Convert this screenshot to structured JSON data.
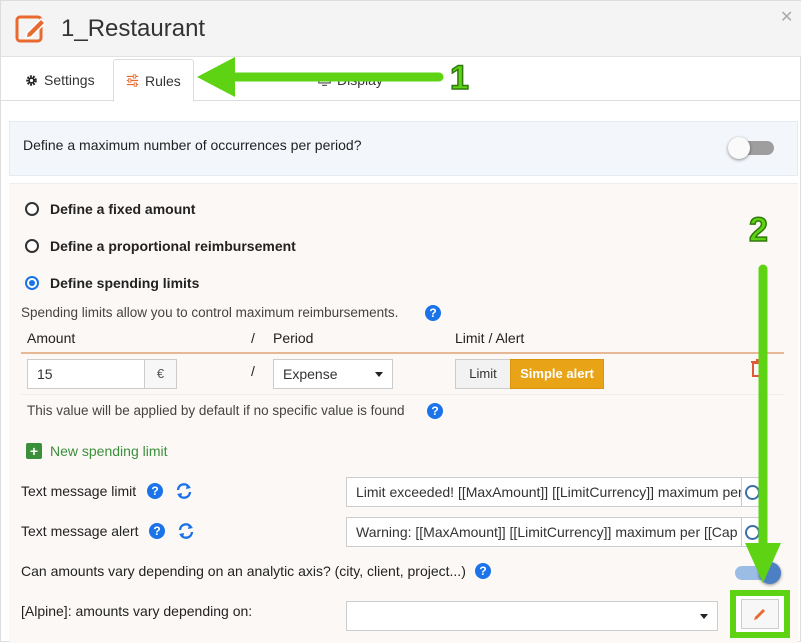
{
  "window": {
    "title": "1_Restaurant"
  },
  "tabs": [
    {
      "label": "Settings",
      "icon": "gear-icon"
    },
    {
      "label": "Rules",
      "icon": "sliders-icon",
      "active": true
    },
    {
      "label": "Display",
      "icon": "display-icon"
    }
  ],
  "annotations": {
    "marker1": "1",
    "marker2": "2",
    "arrow_color": "#5ed313"
  },
  "max_occurrences": {
    "question": "Define a maximum number of occurrences per period?",
    "enabled": false
  },
  "options": [
    {
      "label": "Define a fixed amount",
      "selected": false
    },
    {
      "label": "Define a proportional reimbursement",
      "selected": false
    },
    {
      "label": "Define spending limits",
      "selected": true
    }
  ],
  "spending": {
    "description": "Spending limits allow you to control maximum reimbursements.",
    "columns": {
      "amount": "Amount",
      "slash": "/",
      "period": "Period",
      "limit_alert": "Limit / Alert"
    },
    "row": {
      "amount": "15",
      "currency": "€",
      "slash": "/",
      "period": "Expense",
      "limit_label": "Limit",
      "alert_label": "Simple alert"
    },
    "default_note": "This value will be applied by default if no specific value is found",
    "new_limit_label": "New spending limit"
  },
  "messages": {
    "limit_label": "Text message limit",
    "limit_value": "Limit exceeded! [[MaxAmount]] [[LimitCurrency]] maximum per [[Cap",
    "alert_label": "Text message alert",
    "alert_value": "Warning: [[MaxAmount]] [[LimitCurrency]] maximum per [[Cap"
  },
  "analytic": {
    "question": "Can amounts vary depending on an analytic axis? (city, client, project...)",
    "enabled": true,
    "alpine_label": "[Alpine]: amounts vary depending on:",
    "alpine_value": ""
  },
  "colors": {
    "accent": "#e8a317",
    "help_blue": "#1a73e8",
    "brand_orange": "#e86a2e",
    "delete_red": "#e05a3a"
  }
}
